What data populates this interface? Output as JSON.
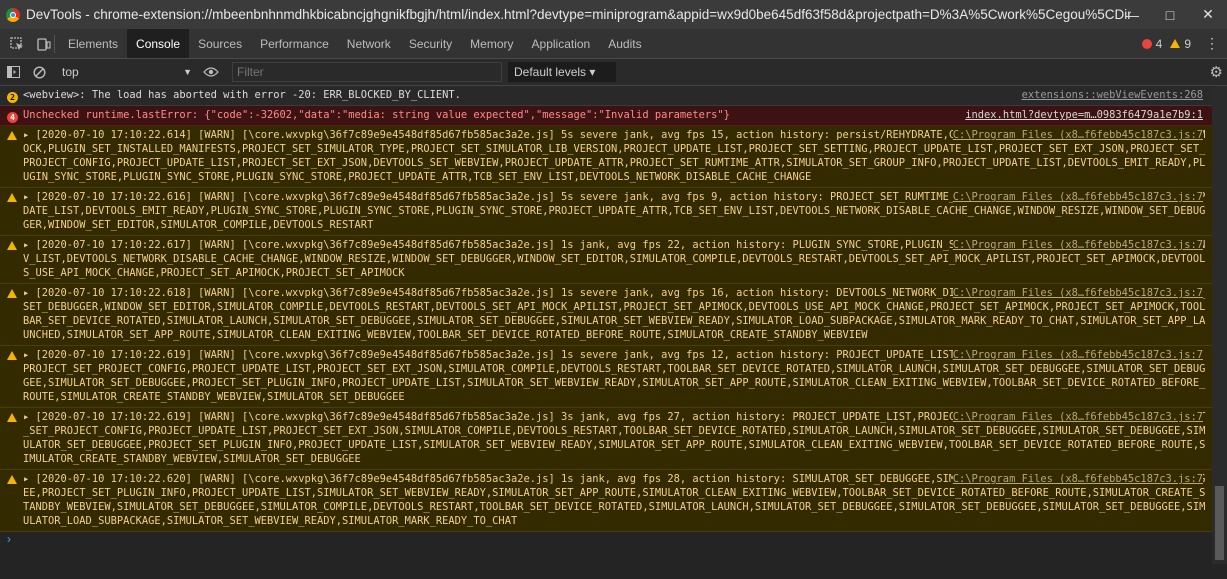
{
  "window": {
    "title": "DevTools - chrome-extension://mbeenbnhnmdhkbicabncjghgnikfbgjh/html/index.html?devtype=miniprogram&appid=wx9d0be645df63f58d&projectpath=D%3A%5Cwork%5Cegou%5CDin...",
    "minimize": "—",
    "maximize": "□",
    "close": "✕"
  },
  "tabs": [
    "Elements",
    "Console",
    "Sources",
    "Performance",
    "Network",
    "Security",
    "Memory",
    "Application",
    "Audits"
  ],
  "counters": {
    "errors": "4",
    "warnings": "9"
  },
  "toolbar": {
    "context": "top",
    "filter_placeholder": "Filter",
    "levels": "Default levels ▾"
  },
  "messages": [
    {
      "type": "info",
      "badge": "2",
      "text": "<webview>: The load has aborted with error -20: ERR_BLOCKED_BY_CLIENT.",
      "source": "extensions::webViewEvents:268"
    },
    {
      "type": "error",
      "badge": "4",
      "text": "Unchecked runtime.lastError: {\"code\":-32602,\"data\":\"media: string value expected\",\"message\":\"Invalid parameters\"}",
      "source": "index.html?devtype=m…0983f6479a1e7b9:1"
    },
    {
      "type": "warn",
      "text": "▸ [2020-07-10 17:10:22.614] [WARN] [\\core.wxvpkg\\36f7c89e9e4548df85d67fb585ac3a2e.js] 5s severe jank, avg fps 15, action history: persist/REHYDRATE,CONFIG_UPDATE_SCENE_INFO,PROJECT_SET_APIMOCK,PLUGIN_SET_INSTALLED_MANIFESTS,PROJECT_SET_SIMULATOR_TYPE,PROJECT_SET_SIMULATOR_LIB_VERSION,PROJECT_UPDATE_LIST,PROJECT_SET_SETTING,PROJECT_UPDATE_LIST,PROJECT_SET_EXT_JSON,PROJECT_SET_PROJECT_CONFIG,PROJECT_UPDATE_LIST,PROJECT_SET_EXT_JSON,DEVTOOLS_SET_WEBVIEW,PROJECT_UPDATE_ATTR,PROJECT_SET_RUMTIME_ATTR,SIMULATOR_SET_GROUP_INFO,PROJECT_UPDATE_LIST,DEVTOOLS_EMIT_READY,PLUGIN_SYNC_STORE,PLUGIN_SYNC_STORE,PLUGIN_SYNC_STORE,PROJECT_UPDATE_ATTR,TCB_SET_ENV_LIST,DEVTOOLS_NETWORK_DISABLE_CACHE_CHANGE",
      "source": "C:\\Program Files (x8…f6febb45c187c3.js:7"
    },
    {
      "type": "warn",
      "text": "▸ [2020-07-10 17:10:22.616] [WARN] [\\core.wxvpkg\\36f7c89e9e4548df85d67fb585ac3a2e.js] 5s severe jank, avg fps 9, action history: PROJECT_SET_RUMTIME_ATTR,SIMULATOR_SET_GROUP_INFO,PROJECT_UPDATE_LIST,DEVTOOLS_EMIT_READY,PLUGIN_SYNC_STORE,PLUGIN_SYNC_STORE,PLUGIN_SYNC_STORE,PROJECT_UPDATE_ATTR,TCB_SET_ENV_LIST,DEVTOOLS_NETWORK_DISABLE_CACHE_CHANGE,WINDOW_RESIZE,WINDOW_SET_DEBUGGER,WINDOW_SET_EDITOR,SIMULATOR_COMPILE,DEVTOOLS_RESTART",
      "source": "C:\\Program Files (x8…f6febb45c187c3.js:7"
    },
    {
      "type": "warn",
      "text": "▸ [2020-07-10 17:10:22.617] [WARN] [\\core.wxvpkg\\36f7c89e9e4548df85d67fb585ac3a2e.js] 1s jank, avg fps 22, action history: PLUGIN_SYNC_STORE,PLUGIN_SYNC_STORE,PROJECT_UPDATE_ATTR,TCB_SET_ENV_LIST,DEVTOOLS_NETWORK_DISABLE_CACHE_CHANGE,WINDOW_RESIZE,WINDOW_SET_DEBUGGER,WINDOW_SET_EDITOR,SIMULATOR_COMPILE,DEVTOOLS_RESTART,DEVTOOLS_SET_API_MOCK_APILIST,PROJECT_SET_APIMOCK,DEVTOOLS_USE_API_MOCK_CHANGE,PROJECT_SET_APIMOCK,PROJECT_SET_APIMOCK",
      "source": "C:\\Program Files (x8…f6febb45c187c3.js:7"
    },
    {
      "type": "warn",
      "text": "▸ [2020-07-10 17:10:22.618] [WARN] [\\core.wxvpkg\\36f7c89e9e4548df85d67fb585ac3a2e.js] 1s severe jank, avg fps 16, action history: DEVTOOLS_NETWORK_DISABLE_CACHE_CHANGE,WINDOW_RESIZE,WINDOW_SET_DEBUGGER,WINDOW_SET_EDITOR,SIMULATOR_COMPILE,DEVTOOLS_RESTART,DEVTOOLS_SET_API_MOCK_APILIST,PROJECT_SET_APIMOCK,DEVTOOLS_USE_API_MOCK_CHANGE,PROJECT_SET_APIMOCK,PROJECT_SET_APIMOCK,TOOLBAR_SET_DEVICE_ROTATED,SIMULATOR_LAUNCH,SIMULATOR_SET_DEBUGGEE,SIMULATOR_SET_DEBUGGEE,SIMULATOR_SET_WEBVIEW_READY,SIMULATOR_LOAD_SUBPACKAGE,SIMULATOR_MARK_READY_TO_CHAT,SIMULATOR_SET_APP_LAUNCHED,SIMULATOR_SET_APP_ROUTE,SIMULATOR_CLEAN_EXITING_WEBVIEW,TOOLBAR_SET_DEVICE_ROTATED_BEFORE_ROUTE,SIMULATOR_CREATE_STANDBY_WEBVIEW",
      "source": "C:\\Program Files (x8…f6febb45c187c3.js:7"
    },
    {
      "type": "warn",
      "text": "▸ [2020-07-10 17:10:22.619] [WARN] [\\core.wxvpkg\\36f7c89e9e4548df85d67fb585ac3a2e.js] 1s severe jank, avg fps 12, action history: PROJECT_UPDATE_LIST,PROJECT_SET_EXT_JSON,PLUGIN_SYNC_STORE,PROJECT_SET_PROJECT_CONFIG,PROJECT_UPDATE_LIST,PROJECT_SET_EXT_JSON,SIMULATOR_COMPILE,DEVTOOLS_RESTART,TOOLBAR_SET_DEVICE_ROTATED,SIMULATOR_LAUNCH,SIMULATOR_SET_DEBUGGEE,SIMULATOR_SET_DEBUGGEE,SIMULATOR_SET_DEBUGGEE,PROJECT_SET_PLUGIN_INFO,PROJECT_UPDATE_LIST,SIMULATOR_SET_WEBVIEW_READY,SIMULATOR_SET_APP_ROUTE,SIMULATOR_CLEAN_EXITING_WEBVIEW,TOOLBAR_SET_DEVICE_ROTATED_BEFORE_ROUTE,SIMULATOR_CREATE_STANDBY_WEBVIEW,SIMULATOR_SET_DEBUGGEE",
      "source": "C:\\Program Files (x8…f6febb45c187c3.js:7"
    },
    {
      "type": "warn",
      "text": "▸ [2020-07-10 17:10:22.619] [WARN] [\\core.wxvpkg\\36f7c89e9e4548df85d67fb585ac3a2e.js] 3s jank, avg fps 27, action history: PROJECT_UPDATE_LIST,PROJECT_SET_EXT_JSON,PLUGIN_SYNC_STORE,PROJECT_SET_PROJECT_CONFIG,PROJECT_UPDATE_LIST,PROJECT_SET_EXT_JSON,SIMULATOR_COMPILE,DEVTOOLS_RESTART,TOOLBAR_SET_DEVICE_ROTATED,SIMULATOR_LAUNCH,SIMULATOR_SET_DEBUGGEE,SIMULATOR_SET_DEBUGGEE,SIMULATOR_SET_DEBUGGEE,PROJECT_SET_PLUGIN_INFO,PROJECT_UPDATE_LIST,SIMULATOR_SET_WEBVIEW_READY,SIMULATOR_SET_APP_ROUTE,SIMULATOR_CLEAN_EXITING_WEBVIEW,TOOLBAR_SET_DEVICE_ROTATED_BEFORE_ROUTE,SIMULATOR_CREATE_STANDBY_WEBVIEW,SIMULATOR_SET_DEBUGGEE",
      "source": "C:\\Program Files (x8…f6febb45c187c3.js:7"
    },
    {
      "type": "warn",
      "text": "▸ [2020-07-10 17:10:22.620] [WARN] [\\core.wxvpkg\\36f7c89e9e4548df85d67fb585ac3a2e.js] 1s jank, avg fps 28, action history: SIMULATOR_SET_DEBUGGEE,SIMULATOR_SET_DEBUGGEE,SIMULATOR_SET_DEBUGGEE,PROJECT_SET_PLUGIN_INFO,PROJECT_UPDATE_LIST,SIMULATOR_SET_WEBVIEW_READY,SIMULATOR_SET_APP_ROUTE,SIMULATOR_CLEAN_EXITING_WEBVIEW,TOOLBAR_SET_DEVICE_ROTATED_BEFORE_ROUTE,SIMULATOR_CREATE_STANDBY_WEBVIEW,SIMULATOR_SET_DEBUGGEE,SIMULATOR_COMPILE,DEVTOOLS_RESTART,TOOLBAR_SET_DEVICE_ROTATED,SIMULATOR_LAUNCH,SIMULATOR_SET_DEBUGGEE,SIMULATOR_SET_DEBUGGEE,SIMULATOR_SET_DEBUGGEE,SIMULATOR_LOAD_SUBPACKAGE,SIMULATOR_SET_WEBVIEW_READY,SIMULATOR_MARK_READY_TO_CHAT",
      "source": "C:\\Program Files (x8…f6febb45c187c3.js:7"
    }
  ],
  "prompt": "›"
}
